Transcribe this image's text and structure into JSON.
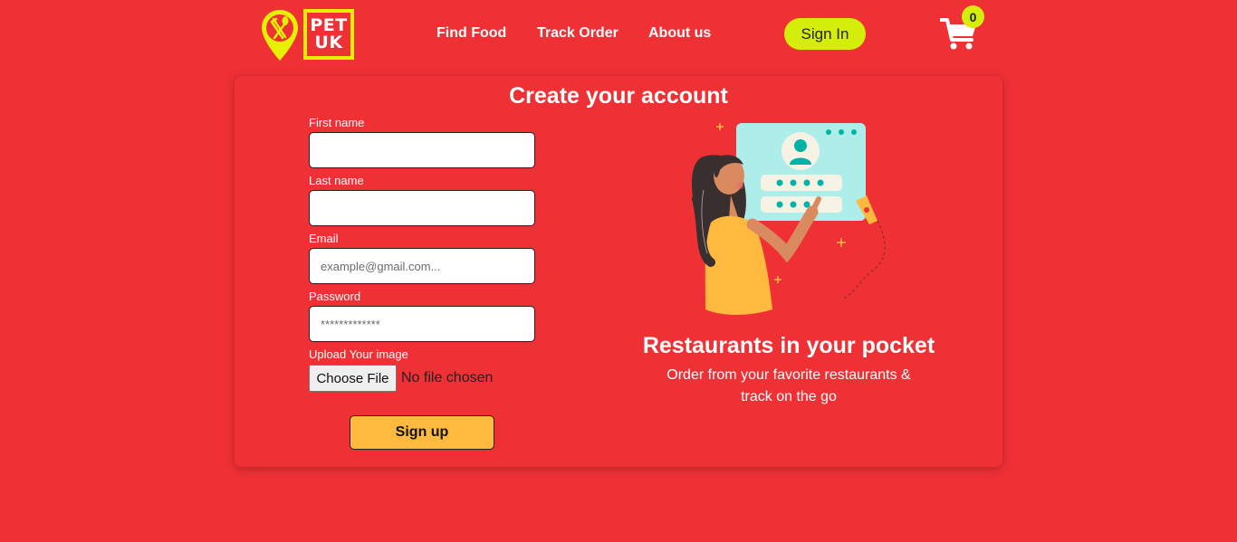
{
  "brand": {
    "line1": "PET",
    "line2": "UK",
    "accent_color": "#e6f000",
    "pin_icon": "fork-spoon-pin-icon"
  },
  "nav": {
    "items": [
      "Find Food",
      "Track Order",
      "About us"
    ],
    "sign_in": "Sign In"
  },
  "cart": {
    "icon": "cart-icon",
    "count": "0"
  },
  "form": {
    "title": "Create your account",
    "first_name_label": "First name",
    "first_name_value": "",
    "last_name_label": "Last name",
    "last_name_value": "",
    "email_label": "Email",
    "email_placeholder": "example@gmail.com...",
    "password_label": "Password",
    "password_placeholder": "*************",
    "upload_label": "Upload Your image",
    "choose_file": "Choose File",
    "no_file": "No file chosen",
    "submit": "Sign up"
  },
  "promo": {
    "title": "Restaurants in your pocket",
    "text_line1": "Order from your favorite restaurants &",
    "text_line2": "track on the go"
  },
  "colors": {
    "background": "#ef3035",
    "button_yellow": "#ffb93f",
    "signin_green": "#d4ed0a"
  }
}
